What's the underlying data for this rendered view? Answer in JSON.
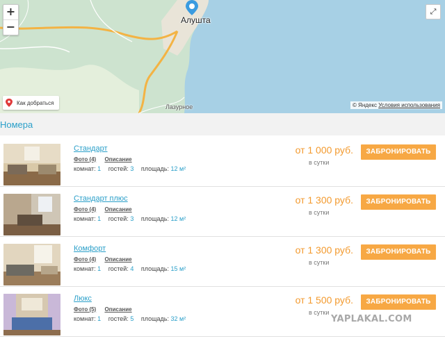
{
  "map": {
    "city_label": "Алушта",
    "town_label": "Лазурное",
    "route_label": "Как добраться",
    "copyright_prefix": "© Яндекс",
    "terms_link": "Условия использования",
    "zoom_in": "+",
    "zoom_out": "−",
    "fullscreen": "⤢",
    "colors": {
      "land": "#cde3cf",
      "sea": "#a7d0e5",
      "road": "#f3b344",
      "pin": "#3a9be0",
      "route_pin": "#e03a3a"
    }
  },
  "section": {
    "title": "Номера"
  },
  "labels": {
    "rooms": "комнат:",
    "guests": "гостей:",
    "area": "площадь:",
    "per_day": "в сутки",
    "description": "Описание",
    "book": "ЗАБРОНИРОВАТЬ"
  },
  "rooms": [
    {
      "name": "Стандарт",
      "photos": "Фото (4)",
      "rooms": "1",
      "guests": "3",
      "area": "12 м²",
      "price": "от 1 000 руб."
    },
    {
      "name": "Стандарт плюс",
      "photos": "Фото (4)",
      "rooms": "1",
      "guests": "3",
      "area": "12 м²",
      "price": "от 1 300 руб."
    },
    {
      "name": "Комфорт",
      "photos": "Фото (4)",
      "rooms": "1",
      "guests": "4",
      "area": "15 м²",
      "price": "от 1 300 руб."
    },
    {
      "name": "Люкс",
      "photos": "Фото (5)",
      "rooms": "1",
      "guests": "5",
      "area": "32 м²",
      "price": "от 1 500 руб."
    }
  ],
  "watermark": "YAPLAKAL.COM"
}
